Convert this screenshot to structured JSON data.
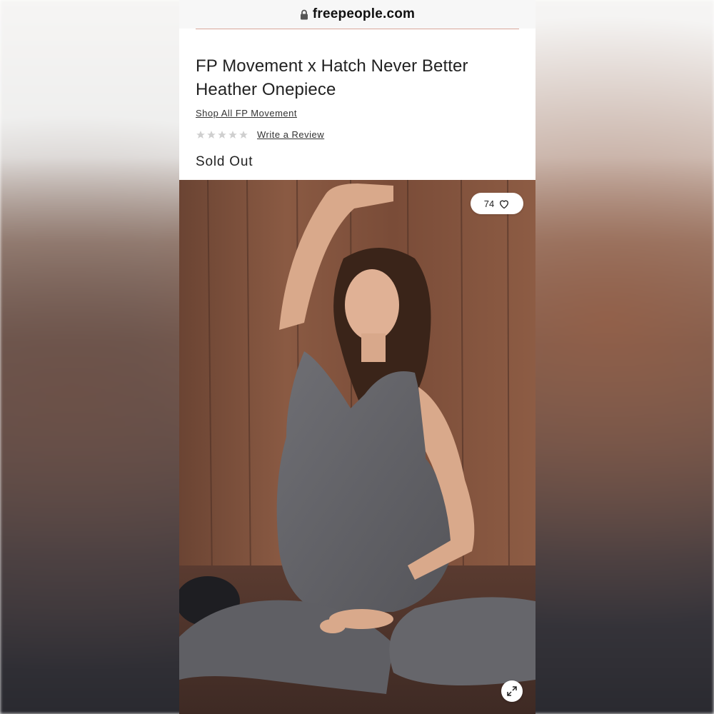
{
  "browser": {
    "url": "freepeople.com",
    "lock_icon": "lock-icon"
  },
  "product": {
    "title": "FP Movement x Hatch Never Better Heather Onepiece",
    "shop_link": "Shop All FP Movement",
    "rating": {
      "stars_filled": 0,
      "stars_total": 5,
      "star_icon": "star-icon",
      "write_review": "Write a Review"
    },
    "status": "Sold Out"
  },
  "image": {
    "like_count": "74",
    "like_icon": "heart-icon",
    "expand_icon": "expand-icon"
  },
  "colors": {
    "divider": "#d9a79a",
    "text": "#222222",
    "star_empty": "#cfcfcf"
  }
}
